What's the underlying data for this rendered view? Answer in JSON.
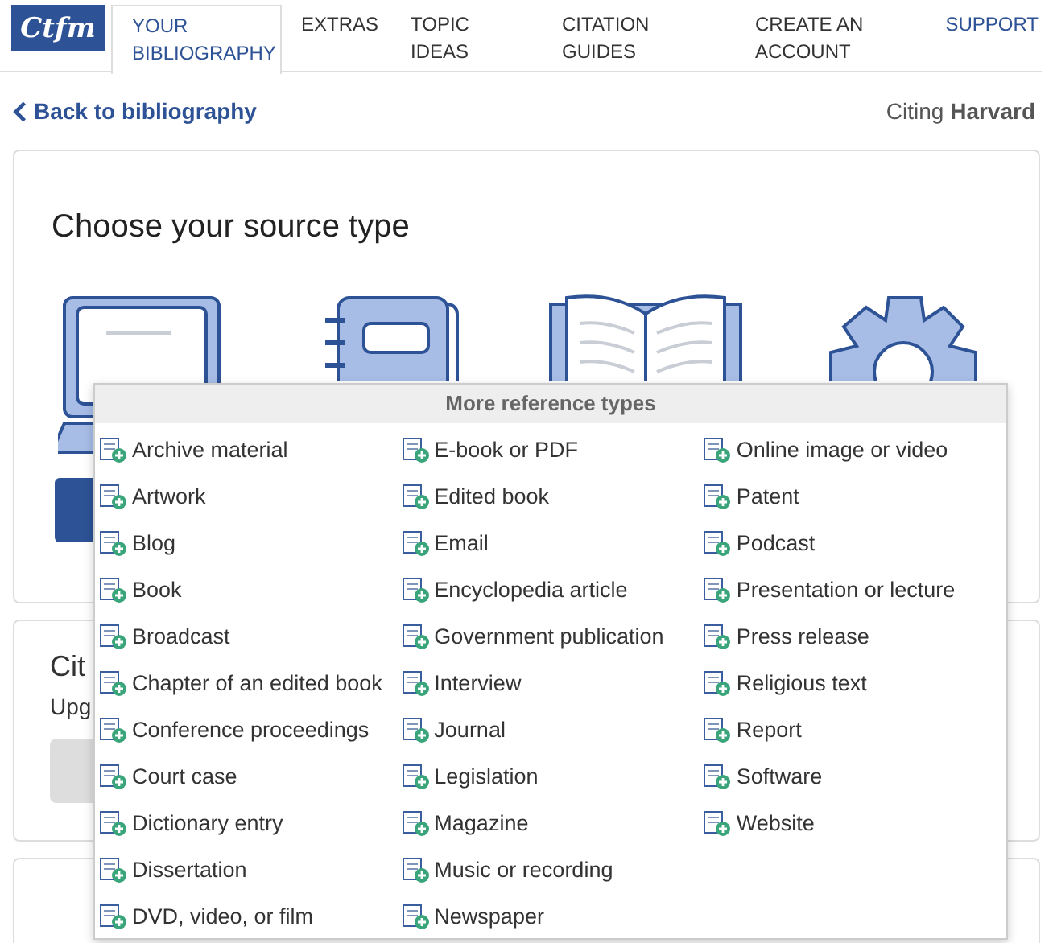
{
  "nav": {
    "logo": "Ctfm",
    "tabs": [
      {
        "label": "YOUR BIBLIOGRAPHY",
        "selected": true
      },
      {
        "label": "EXTRAS",
        "selected": false
      },
      {
        "label": "TOPIC IDEAS",
        "selected": false
      },
      {
        "label": "CITATION GUIDES",
        "selected": false
      },
      {
        "label": "CREATE AN ACCOUNT",
        "selected": false
      },
      {
        "label": "SUPPORT",
        "selected": false,
        "kind": "link"
      }
    ]
  },
  "back_link": "Back to bibliography",
  "citing": "Citing **Harvard**",
  "source_card": {
    "title": "Choose your source type"
  },
  "cite_card": {
    "title": "Cit",
    "text": "Upg"
  },
  "dropdown": {
    "title": "More reference types",
    "columns": [
      [
        "Archive material",
        "Artwork",
        "Blog",
        "Book",
        "Broadcast",
        "Chapter of an edited book",
        "Conference proceedings",
        "Court case",
        "Dictionary entry",
        "Dissertation",
        "DVD, video, or film"
      ],
      [
        "E-book or PDF",
        "Edited book",
        "Email",
        "Encyclopedia article",
        "Government publication",
        "Interview",
        "Journal",
        "Legislation",
        "Magazine",
        "Music or recording",
        "Newspaper"
      ],
      [
        "Online image or video",
        "Patent",
        "Podcast",
        "Presentation or lecture",
        "Press release",
        "Religious text",
        "Report",
        "Software",
        "Website"
      ]
    ]
  }
}
